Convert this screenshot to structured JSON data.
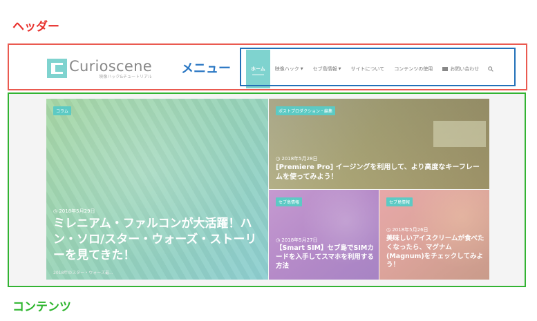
{
  "annotations": {
    "header_label": "ヘッダー",
    "menu_label": "メニュー",
    "content_label": "コンテンツ"
  },
  "logo": {
    "name": "Curioscene",
    "tagline": "映像ハック&チュートリアル"
  },
  "nav": {
    "items": [
      {
        "label": "ホーム",
        "active": true
      },
      {
        "label": "映像ハック",
        "dropdown": true
      },
      {
        "label": "セブ島情報",
        "dropdown": true
      },
      {
        "label": "サイトについて"
      },
      {
        "label": "コンテンツの使用"
      },
      {
        "label": "お問い合わせ",
        "icon": "mail-icon"
      }
    ],
    "search_icon": "search-icon"
  },
  "posts": {
    "main": {
      "category": "コラム",
      "date": "2018年5月29日",
      "title": "ミレニアム・ファルコンが大活躍！ハン・ソロ/スター・ウォーズ・ストーリーを見てきた！",
      "excerpt": "2018年のスター・ウォーズ最..."
    },
    "premiere": {
      "category": "ポストプロダクション・編集",
      "date": "2018年5月28日",
      "title": "[Premiere Pro] イージングを利用して、より高度なキーフレームを使ってみよう！"
    },
    "sim": {
      "category": "セブ島情報",
      "date": "2018年5月27日",
      "title": "【Smart SIM】セブ島でSIMカードを入手してスマホを利用する方法"
    },
    "magnum": {
      "category": "セブ島情報",
      "date": "2018年5月26日",
      "title": "美味しいアイスクリームが食べたくなったら、マグナム(Magnum)をチェックしてみよう！"
    }
  },
  "colors": {
    "header_frame": "#ea5a50",
    "menu_frame": "#2270b8",
    "content_frame": "#32b332",
    "accent": "#7fd3cf"
  }
}
